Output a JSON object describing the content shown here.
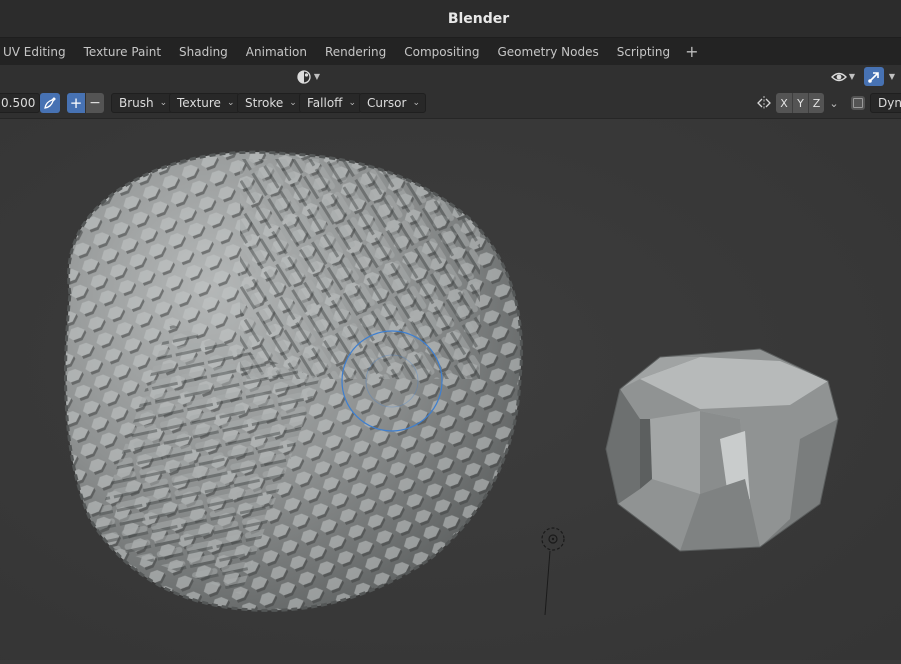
{
  "window": {
    "title": "Blender"
  },
  "workspaces": {
    "tabs": [
      "UV Editing",
      "Texture Paint",
      "Shading",
      "Animation",
      "Rendering",
      "Compositing",
      "Geometry Nodes",
      "Scripting"
    ],
    "add_label": "+"
  },
  "tool_header": {
    "strength_value": "0.500",
    "add_label": "+",
    "subtract_label": "−",
    "menus": [
      "Brush",
      "Texture",
      "Stroke",
      "Falloff",
      "Cursor"
    ],
    "axes": [
      "X",
      "Y",
      "Z"
    ],
    "dyntopo_label": "Dynt"
  },
  "icons": {
    "header": [
      "shading-orb-icon",
      "visibility-eye-icon",
      "gizmo-arrow-icon"
    ],
    "tool": [
      "brush-stroke-icon",
      "mirror-symmetry-icon",
      "checkbox-icon"
    ],
    "viewport": [
      "3d-cursor-icon"
    ]
  },
  "colors": {
    "accent": "#4772b3",
    "brush_circle": "#3d7fd1",
    "viewport_bg": "#3a3a3a",
    "mesh": "#8c8f8f"
  }
}
